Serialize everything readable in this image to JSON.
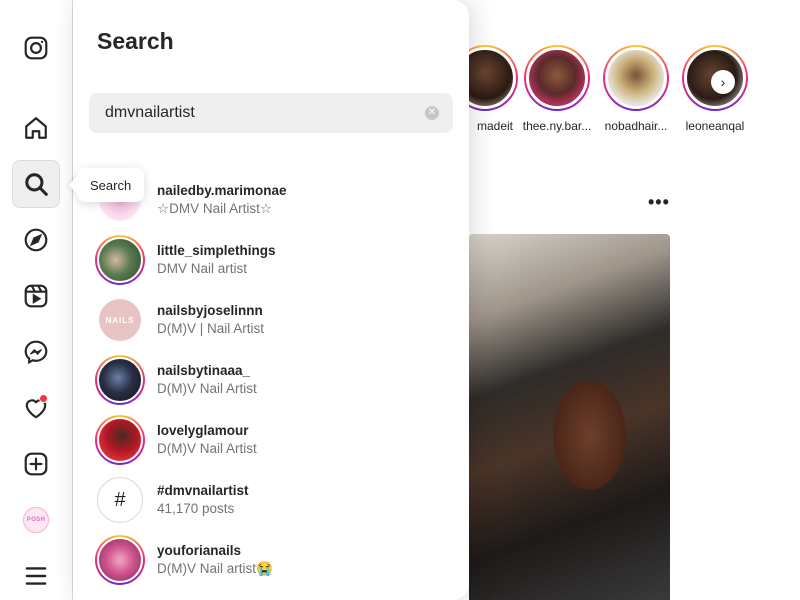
{
  "sidebar": {
    "items": [
      {
        "name": "instagram-logo-icon"
      },
      {
        "name": "home-icon"
      },
      {
        "name": "search-icon"
      },
      {
        "name": "explore-icon"
      },
      {
        "name": "reels-icon"
      },
      {
        "name": "messenger-icon"
      },
      {
        "name": "heart-icon"
      },
      {
        "name": "create-icon"
      },
      {
        "name": "profile-avatar"
      },
      {
        "name": "menu-icon"
      }
    ],
    "profile_badge_text": "POSH",
    "tooltip": "Search",
    "notification_color": "#ff3040"
  },
  "search_panel": {
    "title": "Search",
    "query": "dmvnailartist",
    "clear_icon": "close-circle-icon",
    "results": [
      {
        "name": "nailedby.marimonae",
        "subtitle": "☆DMV Nail Artist☆",
        "ring": false
      },
      {
        "name": "little_simplethings",
        "subtitle": "DMV Nail artist",
        "ring": true
      },
      {
        "name": "nailsbyjoselinnn",
        "subtitle": "D(M)V | Nail Artist",
        "ring": false,
        "avatar_text": "NAILS"
      },
      {
        "name": "nailsbytinaaa_",
        "subtitle": "D(M)V Nail Artist",
        "ring": true
      },
      {
        "name": "lovelyglamour",
        "subtitle": "D(M)V Nail Artist",
        "ring": true
      },
      {
        "name": "#dmvnailartist",
        "subtitle": "41,170 posts",
        "hashtag": true
      },
      {
        "name": "youforianails",
        "subtitle": "D(M)V Nail artist😭",
        "ring": true
      }
    ]
  },
  "feed": {
    "stories": [
      {
        "username": "madeit"
      },
      {
        "username": "thee.ny.bar..."
      },
      {
        "username": "nobadhair..."
      },
      {
        "username": "leoneanqal"
      }
    ],
    "more_label": "•••"
  },
  "colors": {
    "accent_gradient": [
      "#f9ce34",
      "#ee2a7b",
      "#6228d7"
    ],
    "panel_bg": "#ffffff",
    "search_bg": "#efefef"
  }
}
